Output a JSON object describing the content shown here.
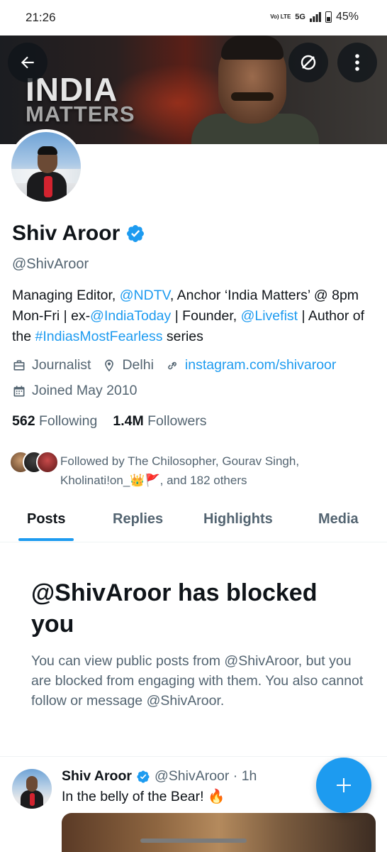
{
  "status_bar": {
    "time": "21:26",
    "volte": "Vo) LTE",
    "network": "5G",
    "battery": "45%"
  },
  "banner": {
    "title_line1": "INDIA",
    "title_line2": "MATTERS"
  },
  "profile": {
    "name": "Shiv Aroor",
    "handle": "@ShivAroor",
    "bio": {
      "p1": "Managing Editor, ",
      "m1": "@NDTV",
      "p2": ", Anchor ‘India Matters’ @ 8pm Mon-Fri | ex-",
      "m2": "@IndiaToday",
      "p3": " | Founder, ",
      "m3": "@Livefist",
      "p4": " | Author of the ",
      "m4": "#IndiasMostFearless",
      "p5": " series"
    },
    "profession": "Journalist",
    "location": "Delhi",
    "website": "instagram.com/shivaroor",
    "joined": "Joined May 2010",
    "following_count": "562",
    "following_label": "Following",
    "followers_count": "1.4M",
    "followers_label": "Followers",
    "followed_by": "Followed by The Chilosopher, Gourav Singh, Kholinati!on_👑🚩, and 182 others"
  },
  "tabs": [
    {
      "label": "Posts"
    },
    {
      "label": "Replies"
    },
    {
      "label": "Highlights"
    },
    {
      "label": "Media"
    }
  ],
  "blocked": {
    "title": "@ShivAroor has blocked you",
    "message": "You can view public posts from @ShivAroor, but you are blocked from engaging with them. You also cannot follow or message @ShivAroor."
  },
  "post": {
    "name": "Shiv Aroor",
    "handle": "@ShivAroor · 1h",
    "text": "In the belly of the Bear! 🔥"
  },
  "colors": {
    "accent": "#1d9bf0",
    "text": "#0f1419",
    "secondary": "#536471"
  },
  "icons": [
    "back-arrow-icon",
    "grok-icon",
    "more-icon",
    "verified-icon",
    "briefcase-icon",
    "location-icon",
    "link-icon",
    "calendar-icon",
    "plus-icon"
  ]
}
